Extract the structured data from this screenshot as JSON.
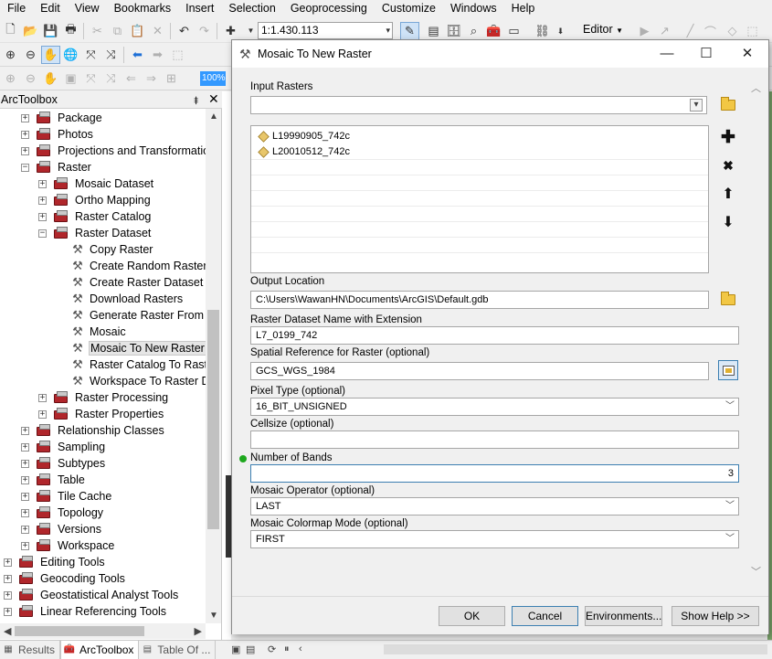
{
  "menubar": [
    "File",
    "Edit",
    "View",
    "Bookmarks",
    "Insert",
    "Selection",
    "Geoprocessing",
    "Customize",
    "Windows",
    "Help"
  ],
  "toolbar": {
    "scale": "1:1.430.113",
    "editor": "Editor",
    "zoom_percent": "100%"
  },
  "arctoolbox": {
    "title": "ArcToolbox",
    "pin": "⯒",
    "close": "✕"
  },
  "tree": [
    {
      "label": "Package",
      "indent": 1,
      "expander": "+",
      "icon": "toolbox"
    },
    {
      "label": "Photos",
      "indent": 1,
      "expander": "+",
      "icon": "toolbox"
    },
    {
      "label": "Projections and Transformations",
      "indent": 1,
      "expander": "+",
      "icon": "toolbox"
    },
    {
      "label": "Raster",
      "indent": 1,
      "expander": "−",
      "icon": "toolbox"
    },
    {
      "label": "Mosaic Dataset",
      "indent": 2,
      "expander": "+",
      "icon": "toolbox"
    },
    {
      "label": "Ortho Mapping",
      "indent": 2,
      "expander": "+",
      "icon": "toolbox"
    },
    {
      "label": "Raster Catalog",
      "indent": 2,
      "expander": "+",
      "icon": "toolbox"
    },
    {
      "label": "Raster Dataset",
      "indent": 2,
      "expander": "−",
      "icon": "toolbox"
    },
    {
      "label": "Copy Raster",
      "indent": 3,
      "expander": "",
      "icon": "tool"
    },
    {
      "label": "Create Random Raster",
      "indent": 3,
      "expander": "",
      "icon": "tool"
    },
    {
      "label": "Create Raster Dataset",
      "indent": 3,
      "expander": "",
      "icon": "tool"
    },
    {
      "label": "Download Rasters",
      "indent": 3,
      "expander": "",
      "icon": "tool"
    },
    {
      "label": "Generate Raster From Raster Function",
      "indent": 3,
      "expander": "",
      "icon": "tool"
    },
    {
      "label": "Mosaic",
      "indent": 3,
      "expander": "",
      "icon": "tool"
    },
    {
      "label": "Mosaic To New Raster",
      "indent": 3,
      "expander": "",
      "icon": "tool",
      "selected": true
    },
    {
      "label": "Raster Catalog To Raster Dataset",
      "indent": 3,
      "expander": "",
      "icon": "tool"
    },
    {
      "label": "Workspace To Raster Dataset",
      "indent": 3,
      "expander": "",
      "icon": "tool"
    },
    {
      "label": "Raster Processing",
      "indent": 2,
      "expander": "+",
      "icon": "toolbox"
    },
    {
      "label": "Raster Properties",
      "indent": 2,
      "expander": "+",
      "icon": "toolbox"
    },
    {
      "label": "Relationship Classes",
      "indent": 1,
      "expander": "+",
      "icon": "toolbox"
    },
    {
      "label": "Sampling",
      "indent": 1,
      "expander": "+",
      "icon": "toolbox"
    },
    {
      "label": "Subtypes",
      "indent": 1,
      "expander": "+",
      "icon": "toolbox"
    },
    {
      "label": "Table",
      "indent": 1,
      "expander": "+",
      "icon": "toolbox"
    },
    {
      "label": "Tile Cache",
      "indent": 1,
      "expander": "+",
      "icon": "toolbox"
    },
    {
      "label": "Topology",
      "indent": 1,
      "expander": "+",
      "icon": "toolbox"
    },
    {
      "label": "Versions",
      "indent": 1,
      "expander": "+",
      "icon": "toolbox"
    },
    {
      "label": "Workspace",
      "indent": 1,
      "expander": "+",
      "icon": "toolbox"
    },
    {
      "label": "Editing Tools",
      "indent": 0,
      "expander": "+",
      "icon": "toolbox"
    },
    {
      "label": "Geocoding Tools",
      "indent": 0,
      "expander": "+",
      "icon": "toolbox"
    },
    {
      "label": "Geostatistical Analyst Tools",
      "indent": 0,
      "expander": "+",
      "icon": "toolbox"
    },
    {
      "label": "Linear Referencing Tools",
      "indent": 0,
      "expander": "+",
      "icon": "toolbox"
    }
  ],
  "bottom_tabs": [
    {
      "label": "Results",
      "active": false
    },
    {
      "label": "ArcToolbox",
      "active": true
    },
    {
      "label": "Table Of ...",
      "active": false
    }
  ],
  "dialog": {
    "title": "Mosaic To New Raster",
    "input_rasters_label": "Input Rasters",
    "input_rasters_value": "",
    "rasters": [
      "L19990905_742c",
      "L20010512_742c"
    ],
    "output_location_label": "Output Location",
    "output_location_value": "C:\\Users\\WawanHN\\Documents\\ArcGIS\\Default.gdb",
    "raster_name_label": "Raster Dataset Name with Extension",
    "raster_name_value": "L7_0199_742",
    "spatial_ref_label": "Spatial Reference for Raster (optional)",
    "spatial_ref_value": "GCS_WGS_1984",
    "pixel_type_label": "Pixel Type (optional)",
    "pixel_type_value": "16_BIT_UNSIGNED",
    "cellsize_label": "Cellsize (optional)",
    "cellsize_value": "",
    "bands_label": "Number of Bands",
    "bands_value": "3",
    "operator_label": "Mosaic Operator (optional)",
    "operator_value": "LAST",
    "colormap_label": "Mosaic Colormap Mode (optional)",
    "colormap_value": "FIRST",
    "ok": "OK",
    "cancel": "Cancel",
    "environments": "Environments...",
    "show_help": "Show Help >>"
  }
}
